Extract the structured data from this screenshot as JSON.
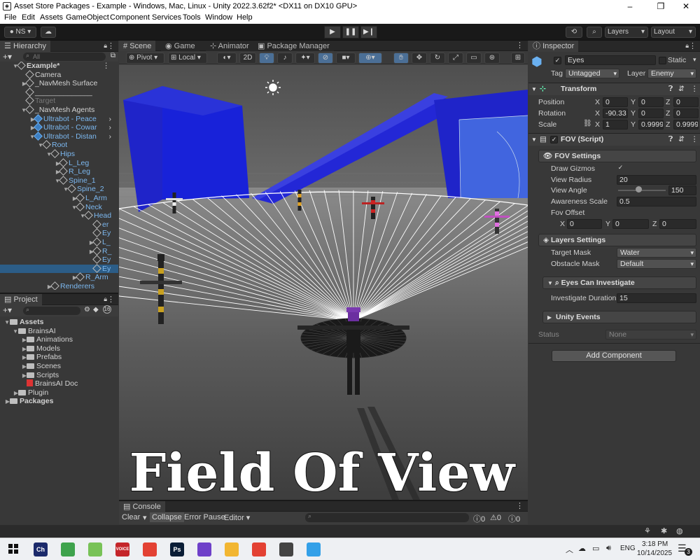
{
  "window": {
    "title": "Asset Store Packages - Example - Windows, Mac, Linux - Unity 2022.3.62f2* <DX11 on DX10 GPU>",
    "minimize": "–",
    "maximize": "❐",
    "close": "✕"
  },
  "menu": [
    "File",
    "Edit",
    "Assets",
    "GameObject",
    "Component",
    "Services",
    "Tools",
    "Window",
    "Help"
  ],
  "toolbar": {
    "account": "NS",
    "layers": "Layers",
    "layout": "Layout"
  },
  "hierarchy": {
    "tab": "Hierarchy",
    "search_placeholder": "All",
    "rows": [
      {
        "label": "Example*",
        "indent": 0,
        "arrow": "▼",
        "icon": "unity-scene-icon",
        "bold": true
      },
      {
        "label": "Camera",
        "indent": 1,
        "arrow": "",
        "icon": "cube"
      },
      {
        "label": "_NavMesh Surface",
        "indent": 1,
        "arrow": "▶",
        "icon": "cube"
      },
      {
        "label": "______________",
        "indent": 1,
        "arrow": "",
        "icon": "cube"
      },
      {
        "label": "Target",
        "indent": 1,
        "arrow": "",
        "icon": "cube",
        "grey": true
      },
      {
        "label": "_NavMesh Agents",
        "indent": 1,
        "arrow": "▼",
        "icon": "cube"
      },
      {
        "label": "Ultrabot - Peace",
        "indent": 2,
        "arrow": "▶",
        "icon": "blue",
        "blue": true,
        "more": true
      },
      {
        "label": "Ultrabot - Cowar",
        "indent": 2,
        "arrow": "▶",
        "icon": "blue",
        "blue": true,
        "more": true
      },
      {
        "label": "Ultrabot - Distan",
        "indent": 2,
        "arrow": "▼",
        "icon": "blue",
        "blue": true,
        "more": true
      },
      {
        "label": "Root",
        "indent": 3,
        "arrow": "▼",
        "icon": "cube",
        "blue": true
      },
      {
        "label": "Hips",
        "indent": 4,
        "arrow": "▼",
        "icon": "cube",
        "blue": true
      },
      {
        "label": "L_Leg",
        "indent": 5,
        "arrow": "▶",
        "icon": "cube",
        "blue": true
      },
      {
        "label": "R_Leg",
        "indent": 5,
        "arrow": "▶",
        "icon": "cube",
        "blue": true
      },
      {
        "label": "Spine_1",
        "indent": 5,
        "arrow": "▼",
        "icon": "cube",
        "blue": true
      },
      {
        "label": "Spine_2",
        "indent": 6,
        "arrow": "▼",
        "icon": "cube",
        "blue": true
      },
      {
        "label": "L_Arm",
        "indent": 7,
        "arrow": "▶",
        "icon": "cube",
        "blue": true
      },
      {
        "label": "Neck",
        "indent": 7,
        "arrow": "▼",
        "icon": "cube",
        "blue": true
      },
      {
        "label": "Head",
        "indent": 8,
        "arrow": "▼",
        "icon": "cube",
        "blue": true
      },
      {
        "label": "er",
        "indent": 9,
        "arrow": "",
        "icon": "cube",
        "blue": true
      },
      {
        "label": "Ey",
        "indent": 9,
        "arrow": "",
        "icon": "cube",
        "blue": true
      },
      {
        "label": "L_",
        "indent": 9,
        "arrow": "▶",
        "icon": "cube",
        "blue": true
      },
      {
        "label": "R_",
        "indent": 9,
        "arrow": "▶",
        "icon": "cube",
        "blue": true
      },
      {
        "label": "Ey",
        "indent": 9,
        "arrow": "",
        "icon": "cube",
        "blue": true
      },
      {
        "label": "Ey",
        "indent": 9,
        "arrow": "",
        "icon": "cube",
        "blue": true,
        "selected": true
      },
      {
        "label": "R_Arm",
        "indent": 7,
        "arrow": "▶",
        "icon": "cube",
        "blue": true
      },
      {
        "label": "Renderers",
        "indent": 4,
        "arrow": "▶",
        "icon": "cube",
        "blue": true
      }
    ]
  },
  "project": {
    "tab": "Project",
    "badge": "16",
    "rows": [
      {
        "label": "Assets",
        "indent": 0,
        "arrow": "▼",
        "bold": true
      },
      {
        "label": "BrainsAI",
        "indent": 1,
        "arrow": "▼"
      },
      {
        "label": "Animations",
        "indent": 2,
        "arrow": "▶"
      },
      {
        "label": "Models",
        "indent": 2,
        "arrow": "▶"
      },
      {
        "label": "Prefabs",
        "indent": 2,
        "arrow": "▶"
      },
      {
        "label": "Scenes",
        "indent": 2,
        "arrow": "▶"
      },
      {
        "label": "Scripts",
        "indent": 2,
        "arrow": "▶"
      },
      {
        "label": "BrainsAI Doc",
        "indent": 2,
        "arrow": "",
        "pdf": true
      },
      {
        "label": "Plugin",
        "indent": 1,
        "arrow": "▶"
      },
      {
        "label": "Packages",
        "indent": 0,
        "arrow": "▶",
        "bold": true
      }
    ]
  },
  "scene": {
    "tabs": [
      "Scene",
      "Game",
      "Animator",
      "Package Manager"
    ],
    "pivot": "Pivot",
    "local": "Local",
    "mode_2d": "2D",
    "overlay_title": "Field Of View",
    "fov_rays": 46
  },
  "console": {
    "tab": "Console",
    "clear": "Clear",
    "collapse": "Collapse",
    "error_pause": "Error Pause",
    "editor": "Editor",
    "counts": [
      "0",
      "0",
      "0"
    ]
  },
  "inspector": {
    "tab": "Inspector",
    "object_name": "Eyes",
    "static_label": "Static",
    "tag_label": "Tag",
    "tag_value": "Untagged",
    "layer_label": "Layer",
    "layer_value": "Enemy",
    "transform": {
      "title": "Transform",
      "position_label": "Position",
      "rotation_label": "Rotation",
      "scale_label": "Scale",
      "position": [
        "0",
        "0",
        "0"
      ],
      "rotation": [
        "-90.33",
        "0",
        "0"
      ],
      "scale": [
        "1",
        "0.9999",
        "0.9999"
      ]
    },
    "fov": {
      "title": "FOV (Script)",
      "settings_title": "FOV Settings",
      "draw_gizmos_label": "Draw Gizmos",
      "draw_gizmos": true,
      "view_radius_label": "View Radius",
      "view_radius": "20",
      "view_angle_label": "View Angle",
      "view_angle": "150",
      "view_angle_fraction": 0.42,
      "awareness_label": "Awareness Scale",
      "awareness": "0.5",
      "fov_offset_label": "Fov Offset",
      "fov_offset": [
        "0",
        "0",
        "0"
      ],
      "layers_title": "Layers Settings",
      "target_mask_label": "Target Mask",
      "target_mask": "Water",
      "obstacle_mask_label": "Obstacle Mask",
      "obstacle_mask": "Default",
      "investigate_title": "Eyes Can Investigate",
      "investigate_label": "Investigate Duration",
      "investigate_value": "15",
      "events_title": "Unity Events",
      "status_label": "Status",
      "status_value": "None"
    },
    "add_component": "Add Component"
  },
  "taskbar": {
    "apps": [
      {
        "name": "ch",
        "label": "Ch",
        "color": "#1b2a6b"
      },
      {
        "name": "bamboo",
        "label": "",
        "color": "#3fa34d"
      },
      {
        "name": "android",
        "label": "",
        "color": "#78c257"
      },
      {
        "name": "voicemeeter",
        "label": "VOICE",
        "color": "#c4252a"
      },
      {
        "name": "chrome",
        "label": "",
        "color": "#e34133"
      },
      {
        "name": "ps",
        "label": "Ps",
        "color": "#0a1d36"
      },
      {
        "name": "github",
        "label": "",
        "color": "#6e40c9"
      },
      {
        "name": "explorer",
        "label": "",
        "color": "#f2b632"
      },
      {
        "name": "chrome2",
        "label": "",
        "color": "#e34133"
      },
      {
        "name": "unity",
        "label": "",
        "color": "#444444"
      },
      {
        "name": "paint",
        "label": "",
        "color": "#33a0e8"
      }
    ],
    "lang": "ENG",
    "time": "3:18 PM",
    "date": "10/14/2025",
    "notif": "3"
  }
}
